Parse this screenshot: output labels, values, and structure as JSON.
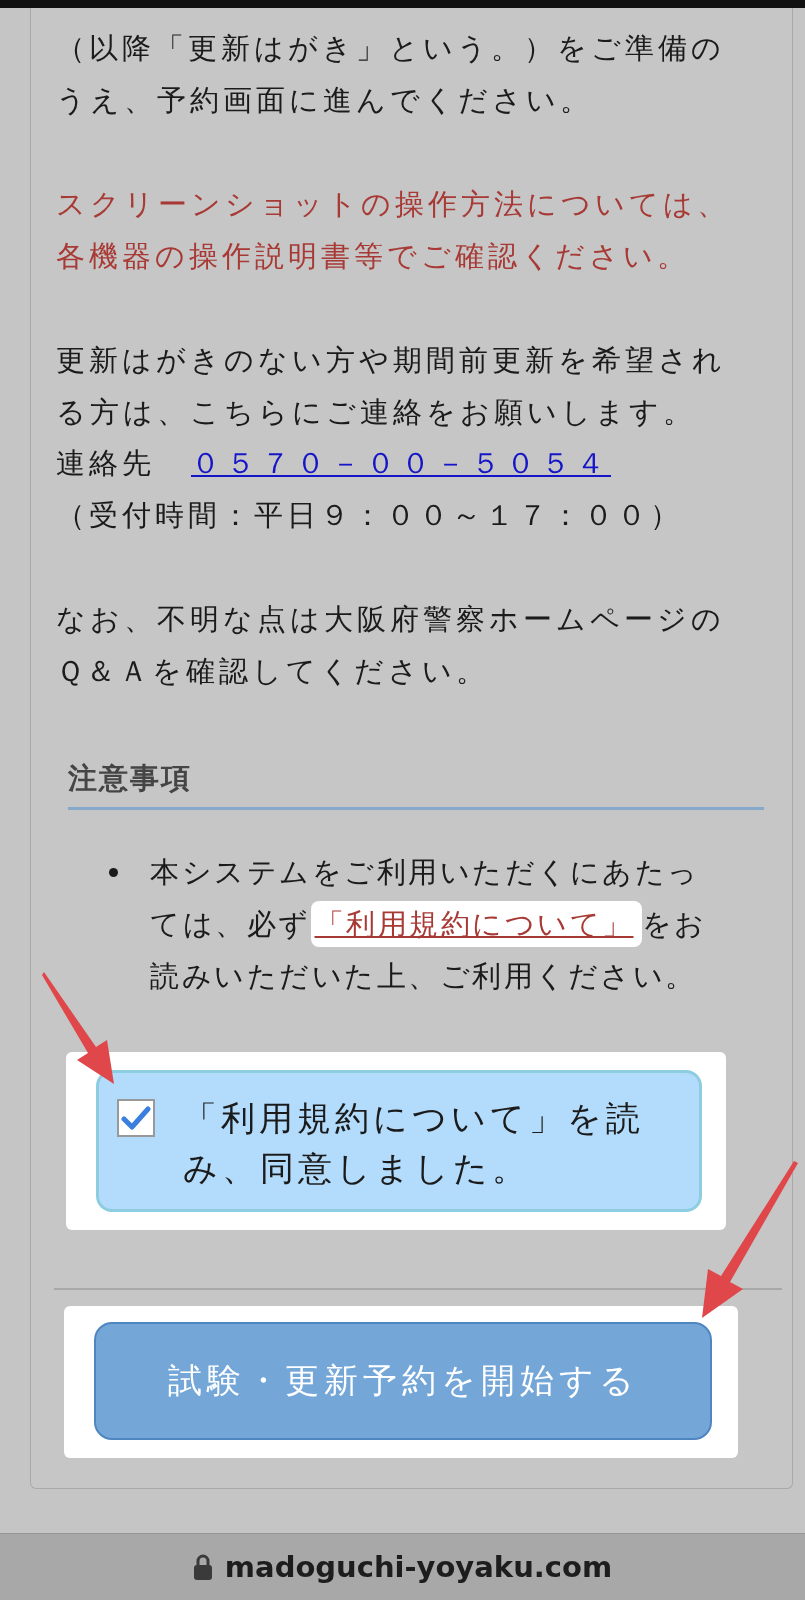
{
  "intro": {
    "lines": [
      "（以降「更新はがき」という。）をご準備の",
      "うえ、予約画面に進んでください。"
    ]
  },
  "screenshot_note": {
    "lines": [
      "スクリーンショットの操作方法については、",
      "各機器の操作説明書等でご確認ください。"
    ]
  },
  "contact": {
    "lines": [
      "更新はがきのない方や期間前更新を希望され",
      "る方は、こちらにご連絡をお願いします。"
    ],
    "label": "連絡先",
    "phone": "０５７０－００－５０５４",
    "hours": "（受付時間：平日９：００～１７：００）"
  },
  "qa": {
    "lines": [
      "なお、不明な点は大阪府警察ホームページの",
      "Ｑ＆Ａを確認してください。"
    ]
  },
  "cautions": {
    "heading": "注意事項",
    "items": [
      {
        "before": "本システムをご利用いただくにあたっては、必ず",
        "link": "「利用規約について」",
        "after": "をお読みいただいた上、ご利用ください。"
      }
    ]
  },
  "agreement": {
    "label": "「利用規約について」を読み、同意しました。",
    "checked": true
  },
  "start_button": {
    "label": "試験・更新予約を開始する"
  },
  "url_bar": {
    "url": "madoguchi-yoyaku.com"
  }
}
